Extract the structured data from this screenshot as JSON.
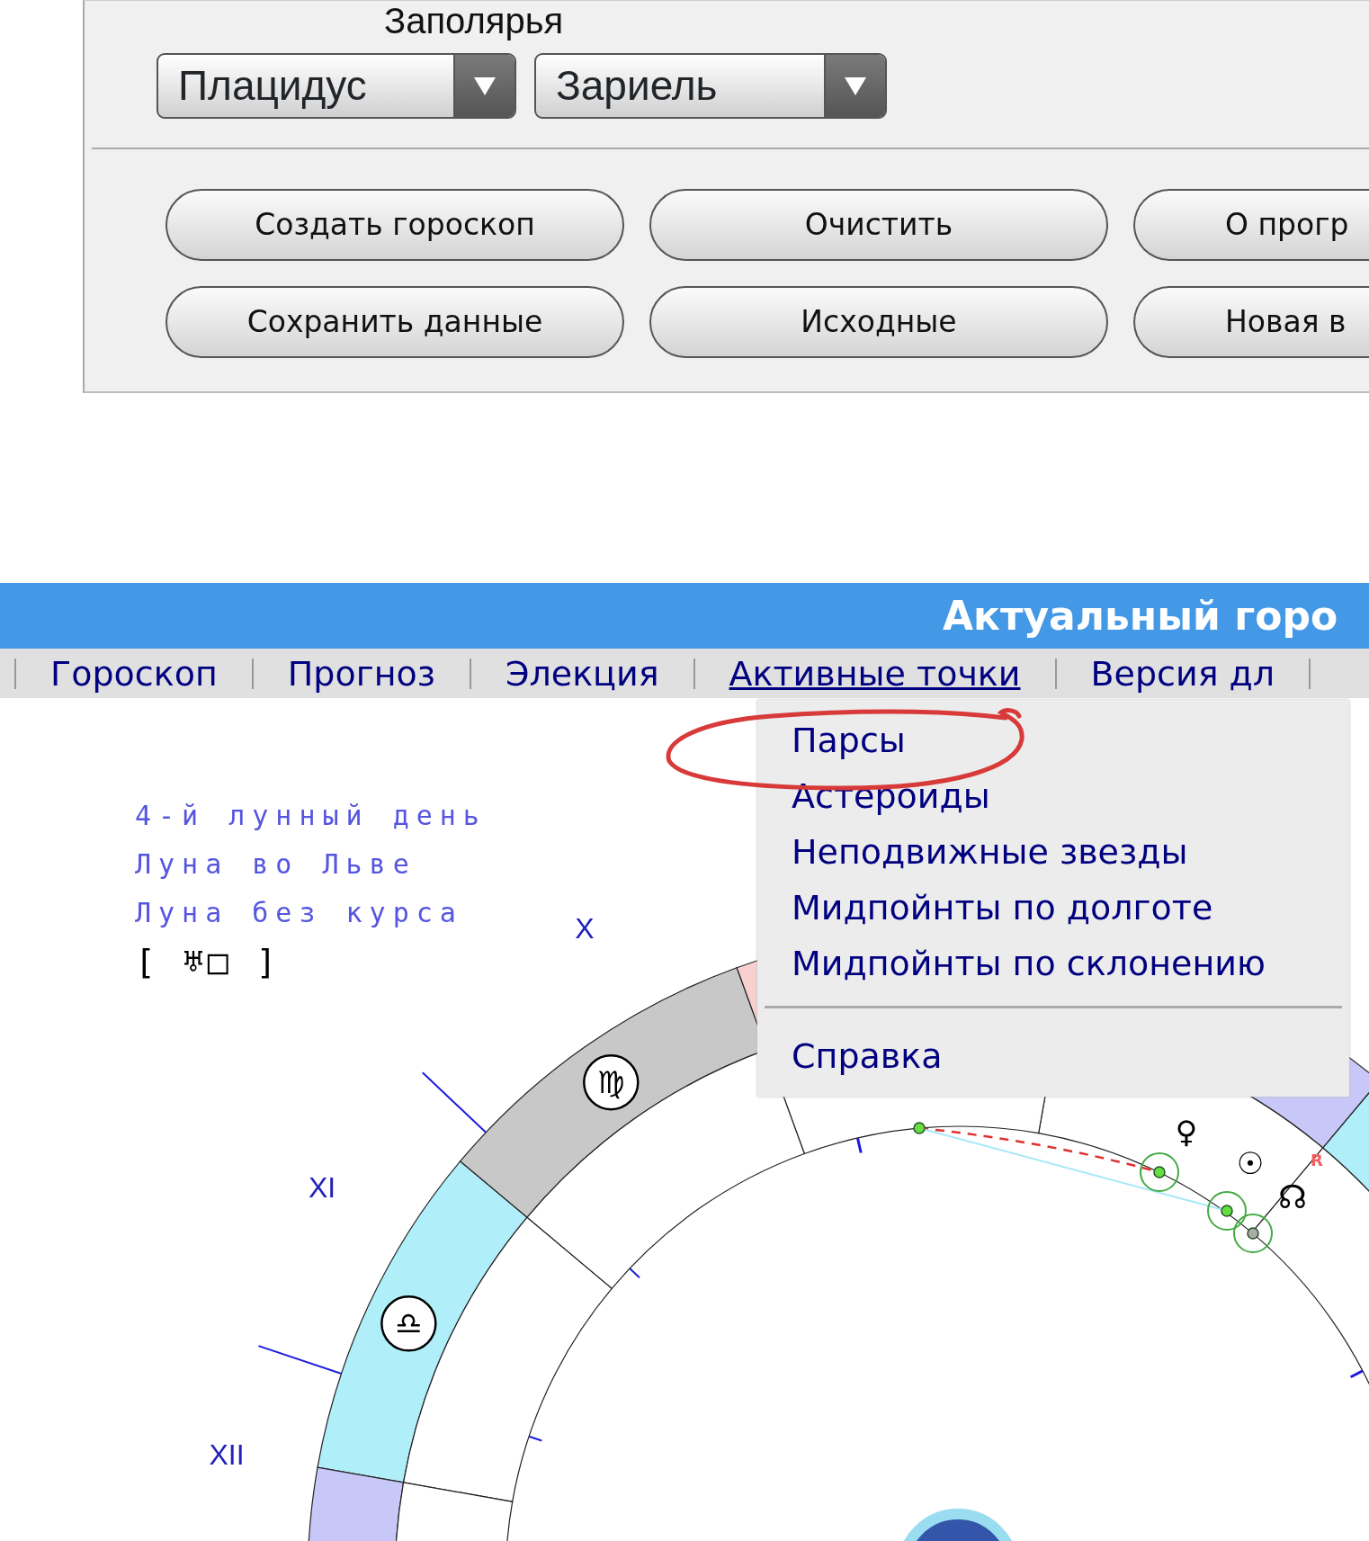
{
  "top_panel": {
    "caption": "Заполярья",
    "dropdowns": [
      {
        "value": "Плацидус"
      },
      {
        "value": "Зариель"
      }
    ],
    "buttons": [
      {
        "label": "Создать гороскоп"
      },
      {
        "label": "Очистить"
      },
      {
        "label": "О прогр"
      },
      {
        "label": "Сохранить данные"
      },
      {
        "label": "Исходные"
      },
      {
        "label": "Новая в"
      }
    ]
  },
  "header": {
    "title": "Актуальный горо"
  },
  "nav": [
    {
      "label": "Гороскоп",
      "selected": false
    },
    {
      "label": "Прогноз",
      "selected": false
    },
    {
      "label": "Элекция",
      "selected": false
    },
    {
      "label": "Активные точки",
      "selected": true
    },
    {
      "label": "Версия дл",
      "selected": false
    }
  ],
  "menu": [
    {
      "kind": "item",
      "label": "Парсы"
    },
    {
      "kind": "item",
      "label": "Астероиды"
    },
    {
      "kind": "item",
      "label": "Неподвижные звезды"
    },
    {
      "kind": "item",
      "label": "Мидпойнты по долготе"
    },
    {
      "kind": "item",
      "label": "Мидпойнты по склонению"
    },
    {
      "kind": "separator"
    },
    {
      "kind": "item",
      "label": "Справка"
    }
  ],
  "chart": {
    "moon_info": [
      "4-й лунный день",
      "Луна во Льве",
      "Луна без курса"
    ],
    "aspect": "[ ♅□ ]",
    "house_labels": [
      "X",
      "XI",
      "XII"
    ],
    "signs": [
      "♍",
      "♎"
    ],
    "planet_glyphs": [
      "♀",
      "☉",
      "☊",
      "R"
    ]
  }
}
